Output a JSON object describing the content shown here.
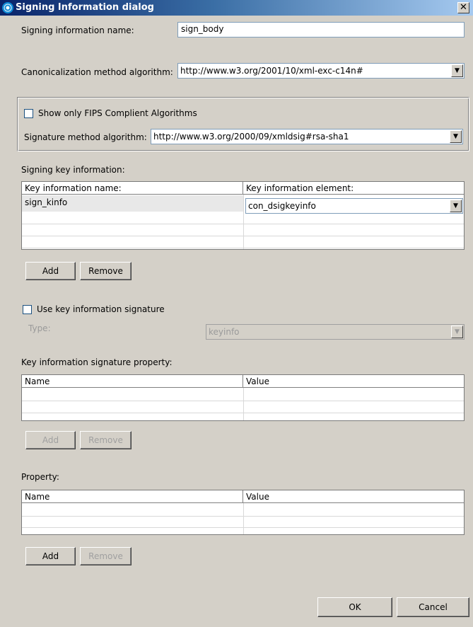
{
  "title": "Signing Information dialog",
  "close_glyph": "✕",
  "signing_info_name": {
    "label": "Signing information name:",
    "value": "sign_body"
  },
  "canonicalization": {
    "label": "Canonicalization method algorithm:",
    "value": "http://www.w3.org/2001/10/xml-exc-c14n#"
  },
  "fips": {
    "label": "Show only FIPS Complient Algorithms",
    "checked": false
  },
  "signature_method": {
    "label": "Signature method algorithm:",
    "value": "http://www.w3.org/2000/09/xmldsig#rsa-sha1"
  },
  "signing_key": {
    "label": "Signing key information:",
    "columns": [
      "Key information name:",
      "Key information element:"
    ],
    "rows": [
      {
        "name": "sign_kinfo",
        "element": "con_dsigkeyinfo"
      }
    ],
    "add_label": "Add",
    "remove_label": "Remove"
  },
  "use_key_sig": {
    "label": "Use key information signature",
    "checked": false,
    "type_label": "Type:",
    "type_value": "keyinfo"
  },
  "key_sig_property": {
    "label": "Key information signature property:",
    "columns": [
      "Name",
      "Value"
    ],
    "add_label": "Add",
    "remove_label": "Remove"
  },
  "property": {
    "label": "Property:",
    "columns": [
      "Name",
      "Value"
    ],
    "add_label": "Add",
    "remove_label": "Remove"
  },
  "footer": {
    "ok_label": "OK",
    "cancel_label": "Cancel"
  },
  "icons": {
    "dropdown": "▼"
  }
}
